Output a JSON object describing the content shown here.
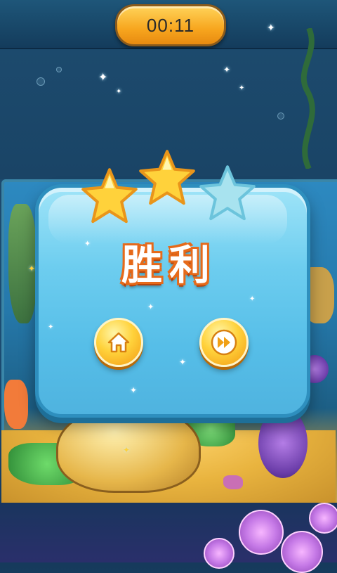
{
  "hud": {
    "timer": "00:11"
  },
  "result": {
    "title": "胜利",
    "stars_earned": 2,
    "stars_total": 3
  },
  "buttons": {
    "home": {
      "icon": "home-icon"
    },
    "next": {
      "icon": "fast-forward-icon"
    }
  },
  "colors": {
    "dialog": "#6dcdef",
    "title_outline": "#e66a1a",
    "star_earned": "#ffd23b",
    "star_empty": "#a8e3ef",
    "button": "#ffd23b"
  }
}
